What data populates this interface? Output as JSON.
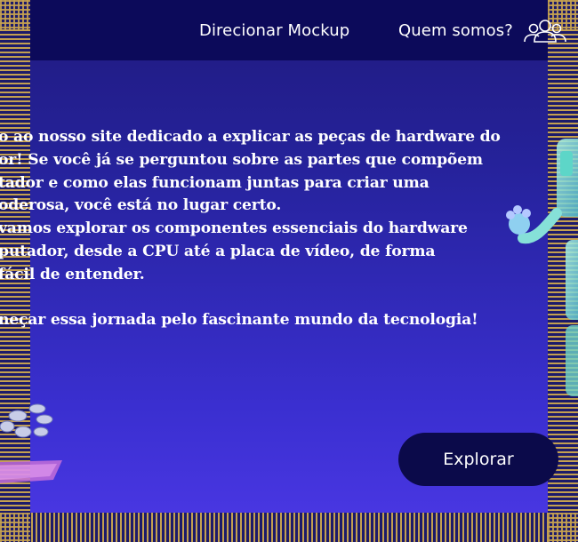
{
  "header": {
    "nav": [
      {
        "label": "Direcionar Mockup"
      },
      {
        "label": "Quem somos?"
      }
    ],
    "users_icon": "users-icon"
  },
  "intro": {
    "lines": [
      "o ao nosso site dedicado a explicar as peças de hardware do",
      "or! Se você já se perguntou sobre as partes que compõem",
      "tador e como elas funcionam juntas para criar uma",
      "oderosa, você está no lugar certo.",
      "vamos explorar os componentes essenciais do hardware",
      "putador, desde a CPU até a placa de vídeo, de forma",
      "fácil de entender.",
      "",
      "neçar essa jornada pelo fascinante mundo da tecnologia!"
    ]
  },
  "cta": {
    "label": "Explorar"
  },
  "colors": {
    "header_bg": "#0c0a5a",
    "bg_top": "#201a7e",
    "bg_bottom": "#4c38e6",
    "stripe_gold": "#c4a050",
    "button_bg": "#0b0a4a"
  },
  "decor": [
    "robot-illustration",
    "robot-hand-illustration"
  ]
}
